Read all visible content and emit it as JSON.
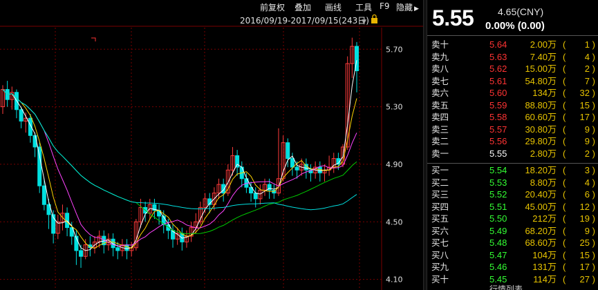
{
  "toolbar": {
    "items": [
      {
        "label": "前复权"
      },
      {
        "label": "叠加"
      },
      {
        "label": "画线"
      },
      {
        "label": "工具"
      },
      {
        "label": "F9"
      },
      {
        "label": "隐藏"
      }
    ]
  },
  "chart": {
    "date_range": "2016/09/19-2017/09/15(243日)",
    "colors": {
      "up": "#ff3b3b",
      "down": "#00e0e0",
      "ma1": "#ffffff",
      "ma2": "#ffd400",
      "ma3": "#ff44ff",
      "ma4": "#00cc00",
      "ma5": "#00e0e0",
      "grid": "#7a0000"
    }
  },
  "chart_data": {
    "type": "candlestick",
    "y_ticks": [
      "5.70",
      "5.30",
      "4.90",
      "4.50",
      "4.10"
    ],
    "ylim": [
      4.05,
      5.85
    ],
    "candles": [
      [
        5.3,
        5.42,
        5.25,
        5.45
      ],
      [
        5.42,
        5.35,
        5.3,
        5.48
      ],
      [
        5.35,
        5.4,
        5.28,
        5.44
      ],
      [
        5.4,
        5.28,
        5.22,
        5.42
      ],
      [
        5.28,
        5.2,
        5.15,
        5.3
      ],
      [
        5.2,
        5.22,
        5.12,
        5.26
      ],
      [
        5.22,
        5.1,
        5.05,
        5.25
      ],
      [
        5.1,
        5.02,
        4.95,
        5.12
      ],
      [
        5.02,
        4.75,
        4.7,
        5.05
      ],
      [
        4.75,
        4.62,
        4.58,
        4.8
      ],
      [
        4.62,
        4.55,
        4.45,
        4.66
      ],
      [
        4.55,
        4.42,
        4.35,
        4.58
      ],
      [
        4.42,
        4.5,
        4.38,
        4.55
      ],
      [
        4.5,
        4.56,
        4.44,
        4.62
      ],
      [
        4.56,
        4.46,
        4.4,
        4.6
      ],
      [
        4.46,
        4.4,
        4.34,
        4.5
      ],
      [
        4.4,
        4.3,
        4.2,
        4.44
      ],
      [
        4.3,
        4.26,
        4.18,
        4.34
      ],
      [
        4.26,
        4.34,
        4.24,
        4.38
      ],
      [
        4.34,
        4.32,
        4.26,
        4.4
      ],
      [
        4.32,
        4.36,
        4.28,
        4.4
      ],
      [
        4.36,
        4.4,
        4.32,
        4.44
      ],
      [
        4.4,
        4.34,
        4.28,
        4.44
      ],
      [
        4.34,
        4.38,
        4.3,
        4.42
      ],
      [
        4.38,
        4.32,
        4.26,
        4.42
      ],
      [
        4.32,
        4.3,
        4.24,
        4.36
      ],
      [
        4.3,
        4.34,
        4.26,
        4.38
      ],
      [
        4.34,
        4.3,
        4.24,
        4.38
      ],
      [
        4.3,
        4.32,
        4.26,
        4.36
      ],
      [
        4.32,
        4.5,
        4.3,
        4.52
      ],
      [
        4.5,
        4.6,
        4.46,
        4.66
      ],
      [
        4.6,
        4.56,
        4.5,
        4.64
      ],
      [
        4.56,
        4.62,
        4.52,
        4.66
      ],
      [
        4.62,
        4.58,
        4.52,
        4.66
      ],
      [
        4.58,
        4.54,
        4.48,
        4.62
      ],
      [
        4.54,
        4.48,
        4.42,
        4.58
      ],
      [
        4.48,
        4.44,
        4.38,
        4.52
      ],
      [
        4.44,
        4.38,
        4.32,
        4.48
      ],
      [
        4.38,
        4.42,
        4.34,
        4.46
      ],
      [
        4.42,
        4.36,
        4.3,
        4.46
      ],
      [
        4.36,
        4.4,
        4.32,
        4.44
      ],
      [
        4.4,
        4.46,
        4.36,
        4.5
      ],
      [
        4.46,
        4.5,
        4.42,
        4.56
      ],
      [
        4.5,
        4.6,
        4.48,
        4.64
      ],
      [
        4.6,
        4.66,
        4.56,
        4.7
      ],
      [
        4.66,
        4.62,
        4.56,
        4.7
      ],
      [
        4.62,
        4.7,
        4.58,
        4.74
      ],
      [
        4.7,
        4.76,
        4.66,
        4.8
      ],
      [
        4.76,
        4.7,
        4.64,
        4.8
      ],
      [
        4.7,
        4.86,
        4.68,
        4.9
      ],
      [
        4.86,
        4.96,
        4.82,
        5.02
      ],
      [
        4.96,
        4.88,
        4.82,
        5.0
      ],
      [
        4.88,
        4.8,
        4.74,
        4.92
      ],
      [
        4.8,
        4.74,
        4.7,
        4.84
      ],
      [
        4.74,
        4.7,
        4.64,
        4.78
      ],
      [
        4.7,
        4.66,
        4.6,
        4.74
      ],
      [
        4.66,
        4.72,
        4.62,
        4.76
      ],
      [
        4.72,
        4.76,
        4.68,
        4.8
      ],
      [
        4.76,
        4.72,
        4.66,
        4.8
      ],
      [
        4.72,
        4.7,
        4.66,
        4.76
      ],
      [
        4.7,
        4.8,
        4.68,
        5.15
      ],
      [
        4.8,
        5.05,
        4.78,
        5.1
      ],
      [
        5.05,
        4.94,
        4.88,
        5.08
      ],
      [
        4.94,
        4.88,
        4.82,
        4.98
      ],
      [
        4.88,
        4.86,
        4.8,
        4.92
      ],
      [
        4.86,
        4.9,
        4.82,
        4.94
      ],
      [
        4.9,
        4.86,
        4.8,
        4.94
      ],
      [
        4.86,
        4.84,
        4.78,
        4.9
      ],
      [
        4.84,
        4.88,
        4.8,
        4.92
      ],
      [
        4.88,
        4.84,
        4.78,
        4.92
      ],
      [
        4.84,
        4.86,
        4.78,
        4.9
      ],
      [
        4.86,
        4.88,
        4.82,
        4.96
      ],
      [
        4.88,
        4.94,
        4.84,
        4.98
      ],
      [
        4.94,
        4.9,
        4.86,
        4.98
      ],
      [
        4.9,
        5.02,
        4.88,
        5.04
      ],
      [
        5.02,
        5.6,
        5.0,
        5.65
      ],
      [
        5.6,
        5.72,
        5.5,
        5.78
      ],
      [
        5.72,
        5.55,
        5.4,
        5.75
      ]
    ]
  },
  "quote": {
    "last": "5.55",
    "prev_close": "4.65(CNY)",
    "change": "0.00% (0.00)",
    "asks": [
      {
        "label": "卖十",
        "price": "5.64",
        "vol": "2.00万",
        "count": "1",
        "color": "#ff3333"
      },
      {
        "label": "卖九",
        "price": "5.63",
        "vol": "7.40万",
        "count": "4",
        "color": "#ff3333"
      },
      {
        "label": "卖八",
        "price": "5.62",
        "vol": "15.00万",
        "count": "2",
        "color": "#ff3333"
      },
      {
        "label": "卖七",
        "price": "5.61",
        "vol": "54.80万",
        "count": "7",
        "color": "#ff3333"
      },
      {
        "label": "卖六",
        "price": "5.60",
        "vol": "134万",
        "count": "32",
        "color": "#ff3333"
      },
      {
        "label": "卖五",
        "price": "5.59",
        "vol": "88.80万",
        "count": "15",
        "color": "#ff3333"
      },
      {
        "label": "卖四",
        "price": "5.58",
        "vol": "60.60万",
        "count": "17",
        "color": "#ff3333"
      },
      {
        "label": "卖三",
        "price": "5.57",
        "vol": "30.80万",
        "count": "9",
        "color": "#ff3333"
      },
      {
        "label": "卖二",
        "price": "5.56",
        "vol": "29.80万",
        "count": "9",
        "color": "#ff3333"
      },
      {
        "label": "卖一",
        "price": "5.55",
        "vol": "2.80万",
        "count": "2",
        "color": "#ffffff"
      }
    ],
    "bids": [
      {
        "label": "买一",
        "price": "5.54",
        "vol": "18.20万",
        "count": "3",
        "color": "#33ff33"
      },
      {
        "label": "买二",
        "price": "5.53",
        "vol": "8.80万",
        "count": "4",
        "color": "#33ff33"
      },
      {
        "label": "买三",
        "price": "5.52",
        "vol": "20.40万",
        "count": "6",
        "color": "#33ff33"
      },
      {
        "label": "买四",
        "price": "5.51",
        "vol": "45.00万",
        "count": "12",
        "color": "#33ff33"
      },
      {
        "label": "买五",
        "price": "5.50",
        "vol": "212万",
        "count": "19",
        "color": "#33ff33"
      },
      {
        "label": "买六",
        "price": "5.49",
        "vol": "68.20万",
        "count": "9",
        "color": "#33ff33"
      },
      {
        "label": "买七",
        "price": "5.48",
        "vol": "68.60万",
        "count": "25",
        "color": "#33ff33"
      },
      {
        "label": "买八",
        "price": "5.47",
        "vol": "104万",
        "count": "15",
        "color": "#33ff33"
      },
      {
        "label": "买九",
        "price": "5.46",
        "vol": "131万",
        "count": "17",
        "color": "#33ff33"
      },
      {
        "label": "买十",
        "price": "5.45",
        "vol": "114万",
        "count": "27",
        "color": "#33ff33"
      }
    ],
    "footer": "行情列表"
  }
}
